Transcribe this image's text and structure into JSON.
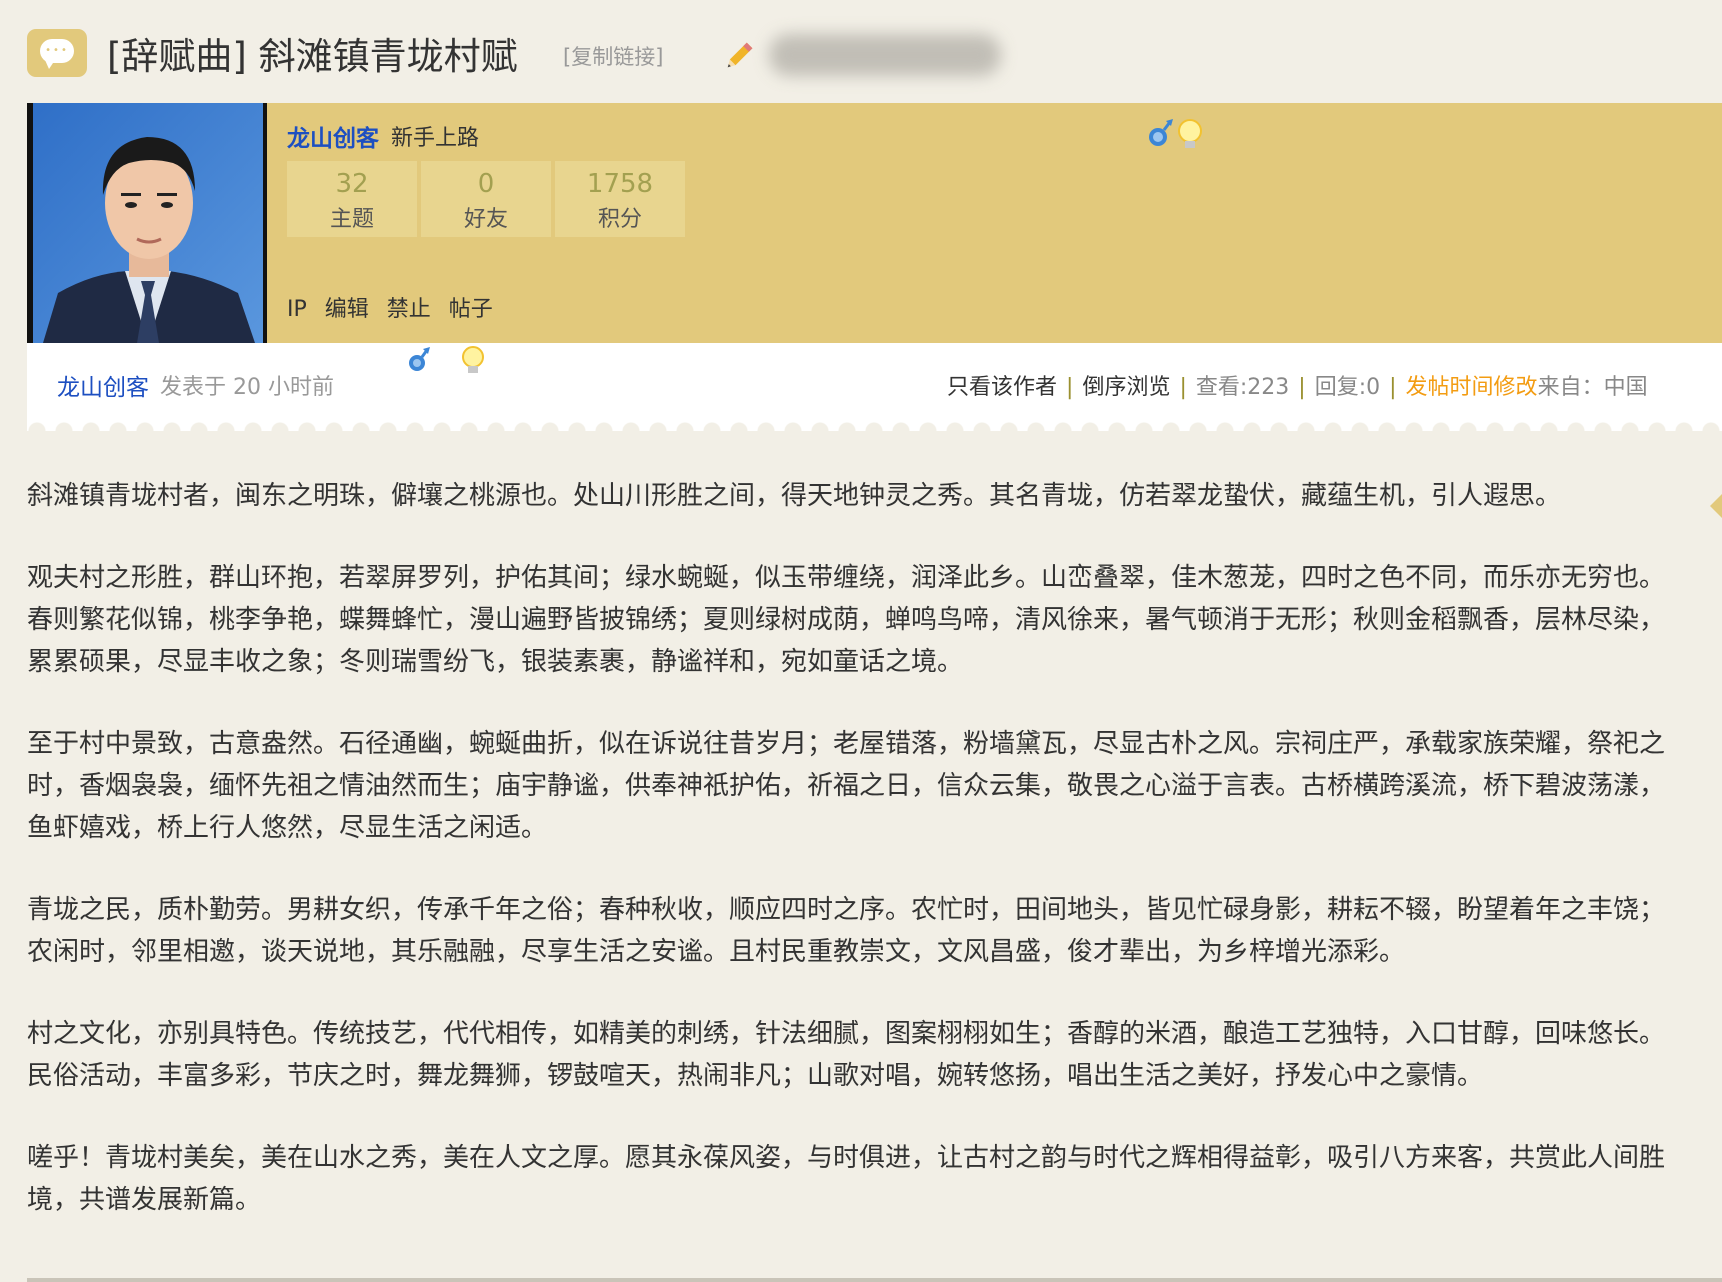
{
  "header": {
    "title": "[辞赋曲] 斜滩镇青垅村赋",
    "copy_link": "[复制链接]"
  },
  "author": {
    "name": "龙山创客",
    "rank": "新手上路",
    "stats": [
      {
        "value": "32",
        "label": "主题"
      },
      {
        "value": "0",
        "label": "好友"
      },
      {
        "value": "1758",
        "label": "积分"
      }
    ],
    "admin_links": [
      "IP",
      "编辑",
      "禁止",
      "帖子"
    ]
  },
  "post_meta": {
    "author": "龙山创客",
    "posted": "发表于 20 小时前",
    "only_author": "只看该作者",
    "reverse": "倒序浏览",
    "views": "查看:223",
    "replies": "回复:0",
    "modify_time": "发帖时间修改",
    "from": "来自：",
    "from_value": "中国"
  },
  "post_body": {
    "paragraphs": [
      "斜滩镇青垅村者，闽东之明珠，僻壤之桃源也。处山川形胜之间，得天地钟灵之秀。其名青垅，仿若翠龙蛰伏，藏蕴生机，引人遐思。",
      "观夫村之形胜，群山环抱，若翠屏罗列，护佑其间；绿水蜿蜒，似玉带缠绕，润泽此乡。山峦叠翠，佳木葱茏，四时之色不同，而乐亦无穷也。春则繁花似锦，桃李争艳，蝶舞蜂忙，漫山遍野皆披锦绣；夏则绿树成荫，蝉鸣鸟啼，清风徐来，暑气顿消于无形；秋则金稻飘香，层林尽染，累累硕果，尽显丰收之象；冬则瑞雪纷飞，银装素裹，静谧祥和，宛如童话之境。",
      "至于村中景致，古意盎然。石径通幽，蜿蜒曲折，似在诉说往昔岁月；老屋错落，粉墙黛瓦，尽显古朴之风。宗祠庄严，承载家族荣耀，祭祀之时，香烟袅袅，缅怀先祖之情油然而生；庙宇静谧，供奉神祇护佑，祈福之日，信众云集，敬畏之心溢于言表。古桥横跨溪流，桥下碧波荡漾，鱼虾嬉戏，桥上行人悠然，尽显生活之闲适。",
      "青垅之民，质朴勤劳。男耕女织，传承千年之俗；春种秋收，顺应四时之序。农忙时，田间地头，皆见忙碌身影，耕耘不辍，盼望着年之丰饶；农闲时，邻里相邀，谈天说地，其乐融融，尽享生活之安谧。且村民重教崇文，文风昌盛，俊才辈出，为乡梓增光添彩。",
      "村之文化，亦别具特色。传统技艺，代代相传，如精美的刺绣，针法细腻，图案栩栩如生；香醇的米酒，酿造工艺独特，入口甘醇，回味悠长。民俗活动，丰富多彩，节庆之时，舞龙舞狮，锣鼓喧天，热闹非凡；山歌对唱，婉转悠扬，唱出生活之美好，抒发心中之豪情。",
      "嗟乎！青垅村美矣，美在山水之秀，美在人文之厚。愿其永葆风姿，与时俱进，让古村之韵与时代之辉相得益彰，吸引八方来客，共赏此人间胜境，共谱发展新篇。"
    ]
  },
  "colors": {
    "accent": "#e2c97c",
    "link": "#1d4fc1",
    "highlight": "#f39c12",
    "background": "#f2efe6"
  },
  "icons": [
    "chat-bubble-icon",
    "pencil-icon",
    "gender-male-icon",
    "lightbulb-icon"
  ]
}
